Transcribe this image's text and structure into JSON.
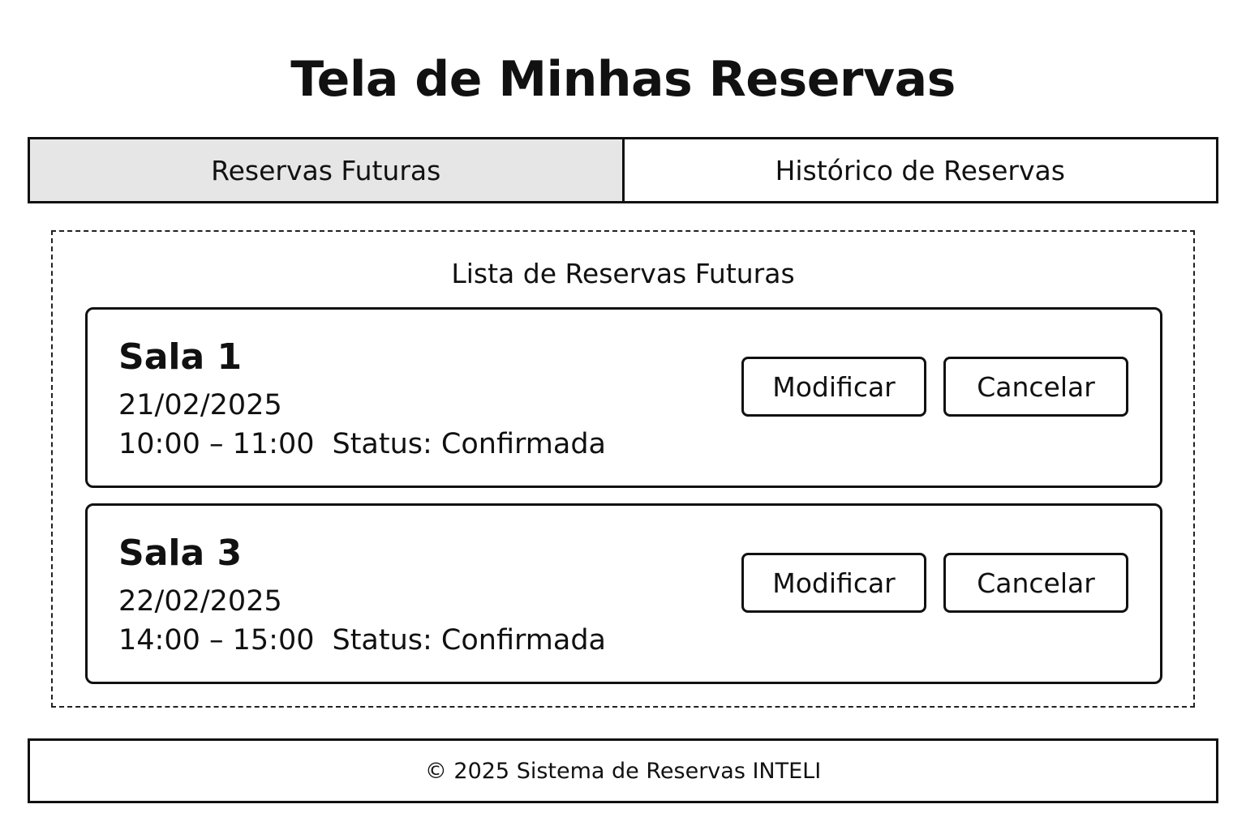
{
  "page": {
    "title": "Tela de Minhas Reservas"
  },
  "tabs": [
    {
      "label": "Reservas Futuras",
      "active": true
    },
    {
      "label": "Histórico de Reservas",
      "active": false
    }
  ],
  "list": {
    "title": "Lista de Reservas Futuras",
    "reservations": [
      {
        "room": "Sala 1",
        "date": "21/02/2025",
        "time": "10:00 – 11:00",
        "status": "Status: Confirmada",
        "modify_label": "Modificar",
        "cancel_label": "Cancelar"
      },
      {
        "room": "Sala 3",
        "date": "22/02/2025",
        "time": "14:00 – 15:00",
        "status": "Status: Confirmada",
        "modify_label": "Modificar",
        "cancel_label": "Cancelar"
      }
    ]
  },
  "footer": {
    "text": "© 2025 Sistema de Reservas INTELI"
  },
  "colors": {
    "active_tab_background": "#e6e6e6",
    "border": "#111111",
    "background": "#ffffff"
  }
}
